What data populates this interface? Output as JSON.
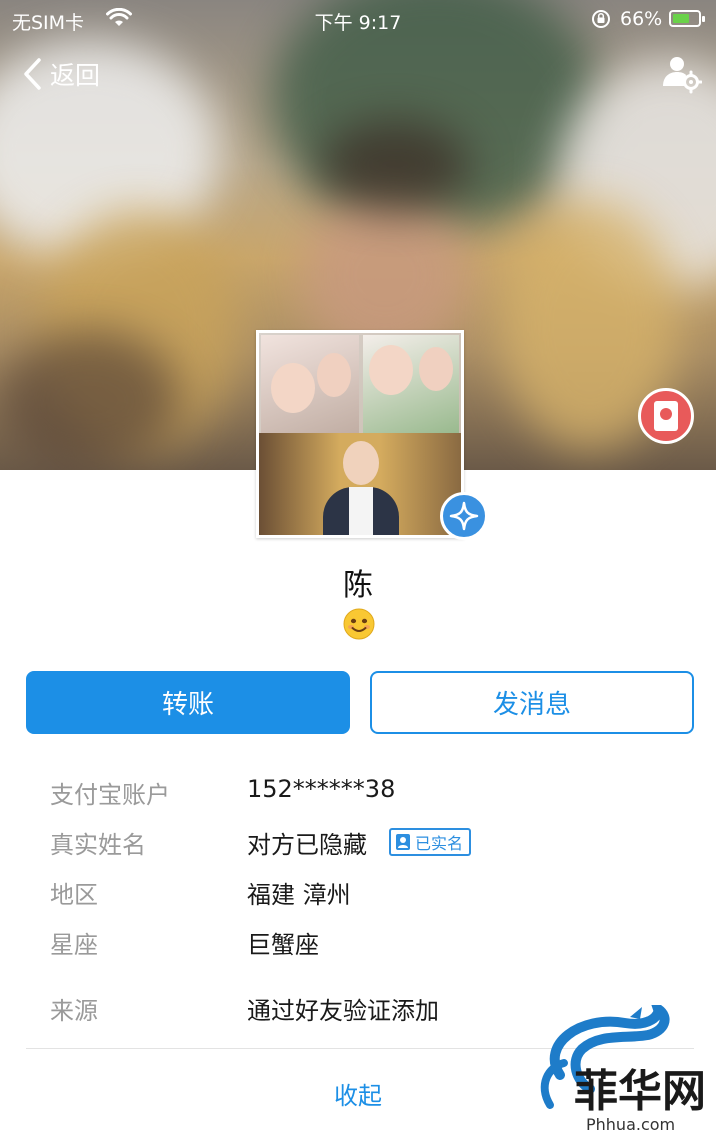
{
  "status_bar": {
    "carrier": "无SIM卡",
    "time": "下午 9:17",
    "battery": "66%",
    "battery_level": 0.66,
    "icons": [
      "wifi-icon",
      "orientation-lock-icon",
      "battery-charging-icon"
    ]
  },
  "nav": {
    "back_label": "返回",
    "settings_icon": "profile-settings-icon"
  },
  "profile": {
    "name": "陈",
    "signature_emoji": "smiling-face-icon",
    "verified_icon": "verified-star-icon",
    "red_packet_icon": "red-packet-icon"
  },
  "actions": {
    "transfer_label": "转账",
    "message_label": "发消息"
  },
  "info": {
    "rows": [
      {
        "label": "支付宝账户",
        "value": "152******38"
      },
      {
        "label": "真实姓名",
        "value": "对方已隐藏"
      },
      {
        "label": "地区",
        "value": "福建 漳州"
      },
      {
        "label": "星座",
        "value": "巨蟹座"
      },
      {
        "label": "来源",
        "value": "通过好友验证添加"
      }
    ],
    "realname_badge": "已实名"
  },
  "footer": {
    "collapse_label": "收起"
  },
  "watermark": {
    "brand": "菲华网",
    "url": "Phhua.com"
  },
  "colors": {
    "accent": "#1c8fe6",
    "label_gray": "#9a9a9a",
    "red_packet": "#e85a5a"
  }
}
